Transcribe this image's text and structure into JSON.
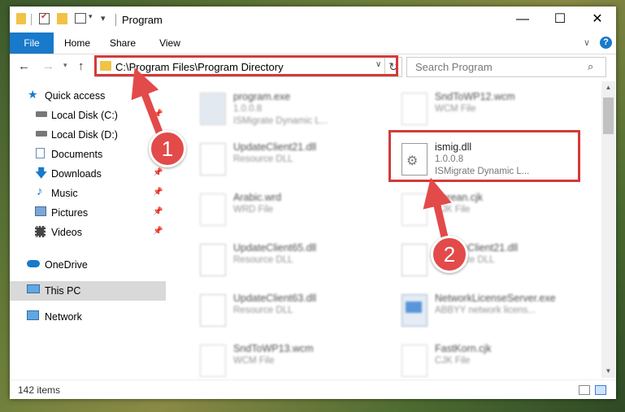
{
  "window": {
    "title": "Program",
    "controls": {
      "minimize": "—",
      "maximize": "☐",
      "close": "✕"
    }
  },
  "ribbon": {
    "tabs": [
      "File",
      "Home",
      "Share",
      "View"
    ],
    "help": "?"
  },
  "nav": {
    "address": "C:\\Program Files\\Program Directory",
    "search_placeholder": "Search Program"
  },
  "sidebar": {
    "items": [
      {
        "label": "Quick access",
        "icon": "star-icon"
      },
      {
        "label": "Local Disk (C:)",
        "icon": "drive-icon"
      },
      {
        "label": "Local Disk (D:)",
        "icon": "drive-icon"
      },
      {
        "label": "Documents",
        "icon": "documents-icon"
      },
      {
        "label": "Downloads",
        "icon": "download-icon"
      },
      {
        "label": "Music",
        "icon": "music-icon"
      },
      {
        "label": "Pictures",
        "icon": "pictures-icon"
      },
      {
        "label": "Videos",
        "icon": "videos-icon"
      },
      {
        "label": "OneDrive",
        "icon": "cloud-icon"
      },
      {
        "label": "This PC",
        "icon": "computer-icon"
      },
      {
        "label": "Network",
        "icon": "network-icon"
      }
    ]
  },
  "files": [
    {
      "name": "program.exe",
      "line2": "1.0.0.8",
      "line3": "ISMigrate Dynamic L...",
      "icon": "exe-icon"
    },
    {
      "name": "SndToWP12.wcm",
      "line2": "WCM File",
      "line3": "",
      "icon": "document-icon"
    },
    {
      "name": "UpdateClient21.dll",
      "line2": "Resource DLL",
      "line3": "",
      "icon": "dll-icon"
    },
    {
      "name": "ismig.dll",
      "line2": "1.0.0.8",
      "line3": "ISMigrate Dynamic L...",
      "icon": "dll-icon"
    },
    {
      "name": "Arabic.wrd",
      "line2": "WRD File",
      "line3": "",
      "icon": "document-icon"
    },
    {
      "name": "Korean.cjk",
      "line2": "CJK File",
      "line3": "",
      "icon": "document-icon"
    },
    {
      "name": "UpdateClient65.dll",
      "line2": "Resource DLL",
      "line3": "",
      "icon": "dll-icon"
    },
    {
      "name": "UpdateClient21.dll",
      "line2": "Resource DLL",
      "line3": "",
      "icon": "dll-icon"
    },
    {
      "name": "UpdateClient63.dll",
      "line2": "Resource DLL",
      "line3": "",
      "icon": "dll-icon"
    },
    {
      "name": "NetworkLicenseServer.exe",
      "line2": "ABBYY network licens...",
      "line3": "",
      "icon": "exe-icon"
    },
    {
      "name": "SndToWP13.wcm",
      "line2": "WCM File",
      "line3": "",
      "icon": "document-icon"
    },
    {
      "name": "FastKorn.cjk",
      "line2": "CJK File",
      "line3": "",
      "icon": "document-icon"
    }
  ],
  "status": {
    "count": "142 items"
  },
  "annotations": {
    "step1": "1",
    "step2": "2",
    "color": "#e34a4a"
  }
}
